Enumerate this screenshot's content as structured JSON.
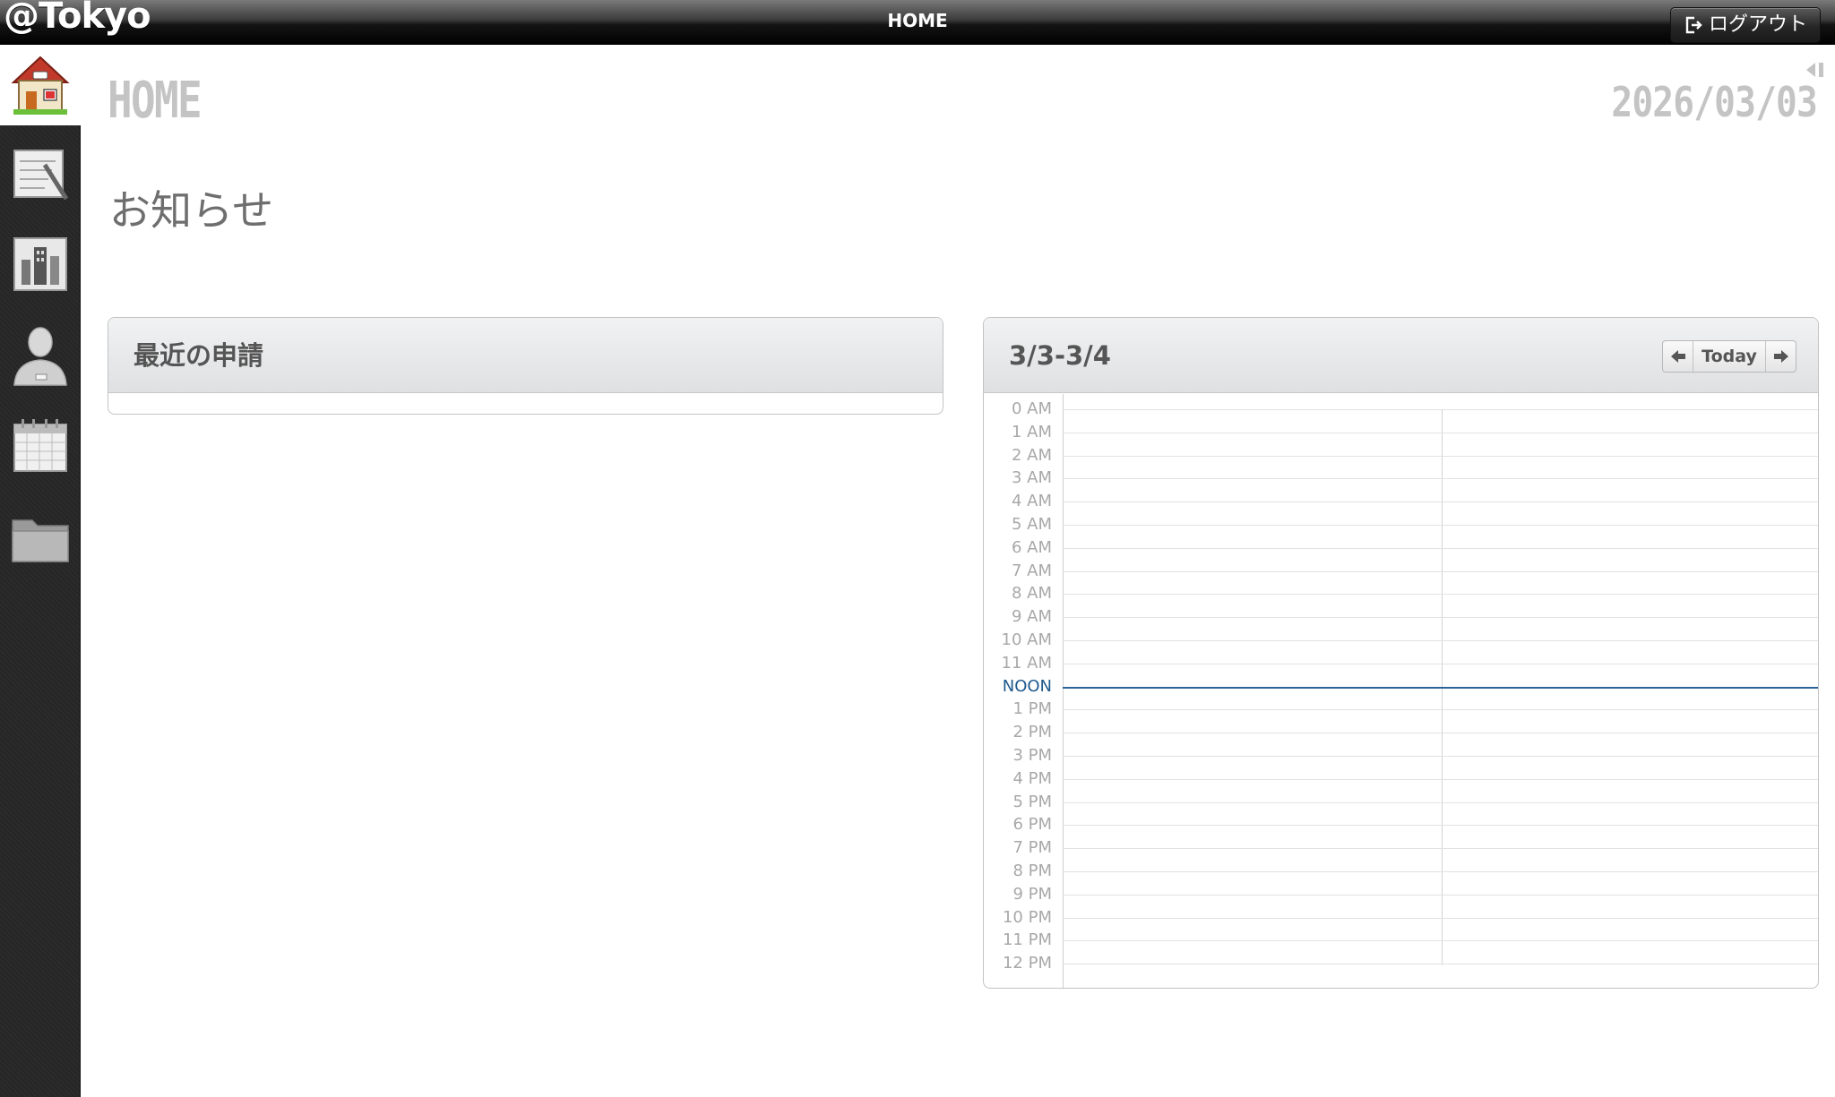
{
  "topbar": {
    "brand": "@Tokyo",
    "title": "HOME",
    "logout_label": "ログアウト"
  },
  "sidebar": {
    "items": [
      {
        "icon": "home-icon",
        "active": true
      },
      {
        "icon": "notepad-icon",
        "active": false
      },
      {
        "icon": "building-icon",
        "active": false
      },
      {
        "icon": "person-icon",
        "active": false
      },
      {
        "icon": "calendar-icon",
        "active": false
      },
      {
        "icon": "folder-icon",
        "active": false
      }
    ]
  },
  "main": {
    "heading": "HOME",
    "date": "2026/03/03",
    "section_title": "お知らせ"
  },
  "recent_panel": {
    "title": "最近の申請"
  },
  "calendar_panel": {
    "range": "3/3-3/4",
    "today_label": "Today",
    "hours": [
      "0 AM",
      "1 AM",
      "2 AM",
      "3 AM",
      "4 AM",
      "5 AM",
      "6 AM",
      "7 AM",
      "8 AM",
      "9 AM",
      "10 AM",
      "11 AM",
      "NOON",
      "1 PM",
      "2 PM",
      "3 PM",
      "4 PM",
      "5 PM",
      "6 PM",
      "7 PM",
      "8 PM",
      "9 PM",
      "10 PM",
      "11 PM",
      "12 PM"
    ],
    "highlight_hour": "NOON",
    "highlight_color": "#2a6496"
  }
}
